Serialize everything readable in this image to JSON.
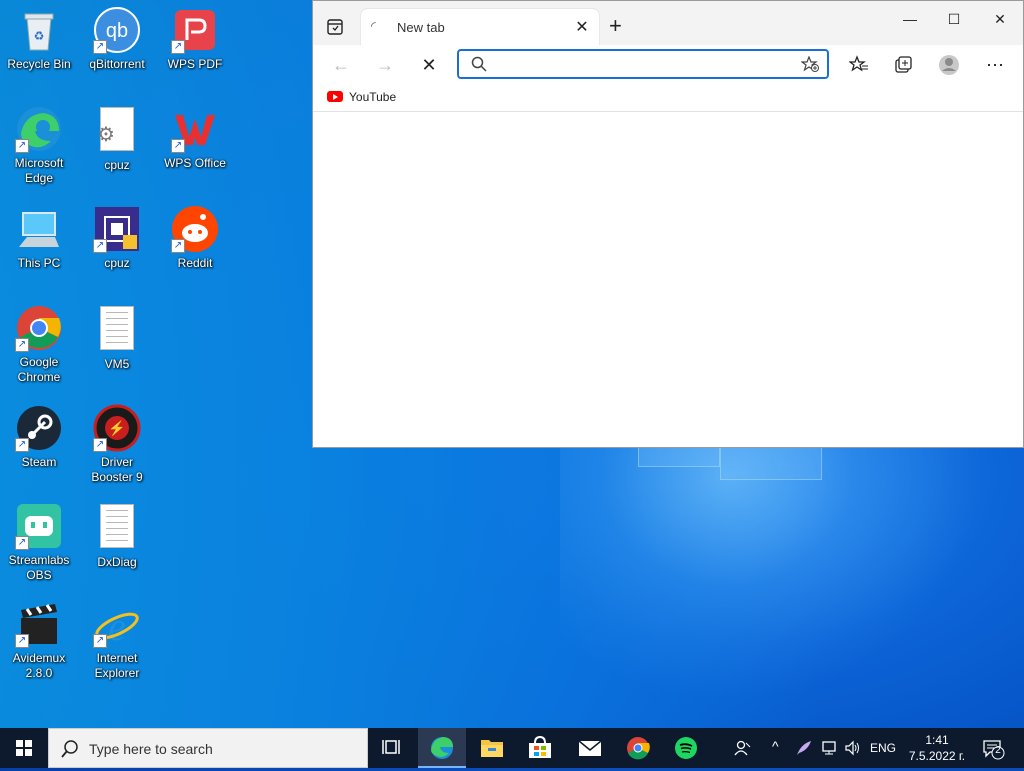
{
  "desktop": {
    "icons": [
      {
        "label": "Recycle Bin"
      },
      {
        "label": "qBittorrent"
      },
      {
        "label": "WPS PDF"
      },
      {
        "label": "Microsoft Edge"
      },
      {
        "label": "cpuz"
      },
      {
        "label": "WPS Office"
      },
      {
        "label": "This PC"
      },
      {
        "label": "cpuz"
      },
      {
        "label": "Reddit"
      },
      {
        "label": "Google Chrome"
      },
      {
        "label": "VM5"
      },
      {
        "label": "Steam"
      },
      {
        "label": "Driver Booster 9"
      },
      {
        "label": "Streamlabs OBS"
      },
      {
        "label": "DxDiag"
      },
      {
        "label": "Avidemux 2.8.0"
      },
      {
        "label": "Internet Explorer"
      }
    ]
  },
  "browser": {
    "tab_title": "New tab",
    "address_value": "",
    "bookmarks": [
      {
        "label": "YouTube"
      }
    ]
  },
  "taskbar": {
    "search_placeholder": "Type here to search",
    "language": "ENG",
    "time": "1:41",
    "date": "7.5.2022 г.",
    "notifications": "2"
  },
  "colors": {
    "accent": "#1a6ed8",
    "taskbar": "#0d1a2e"
  }
}
